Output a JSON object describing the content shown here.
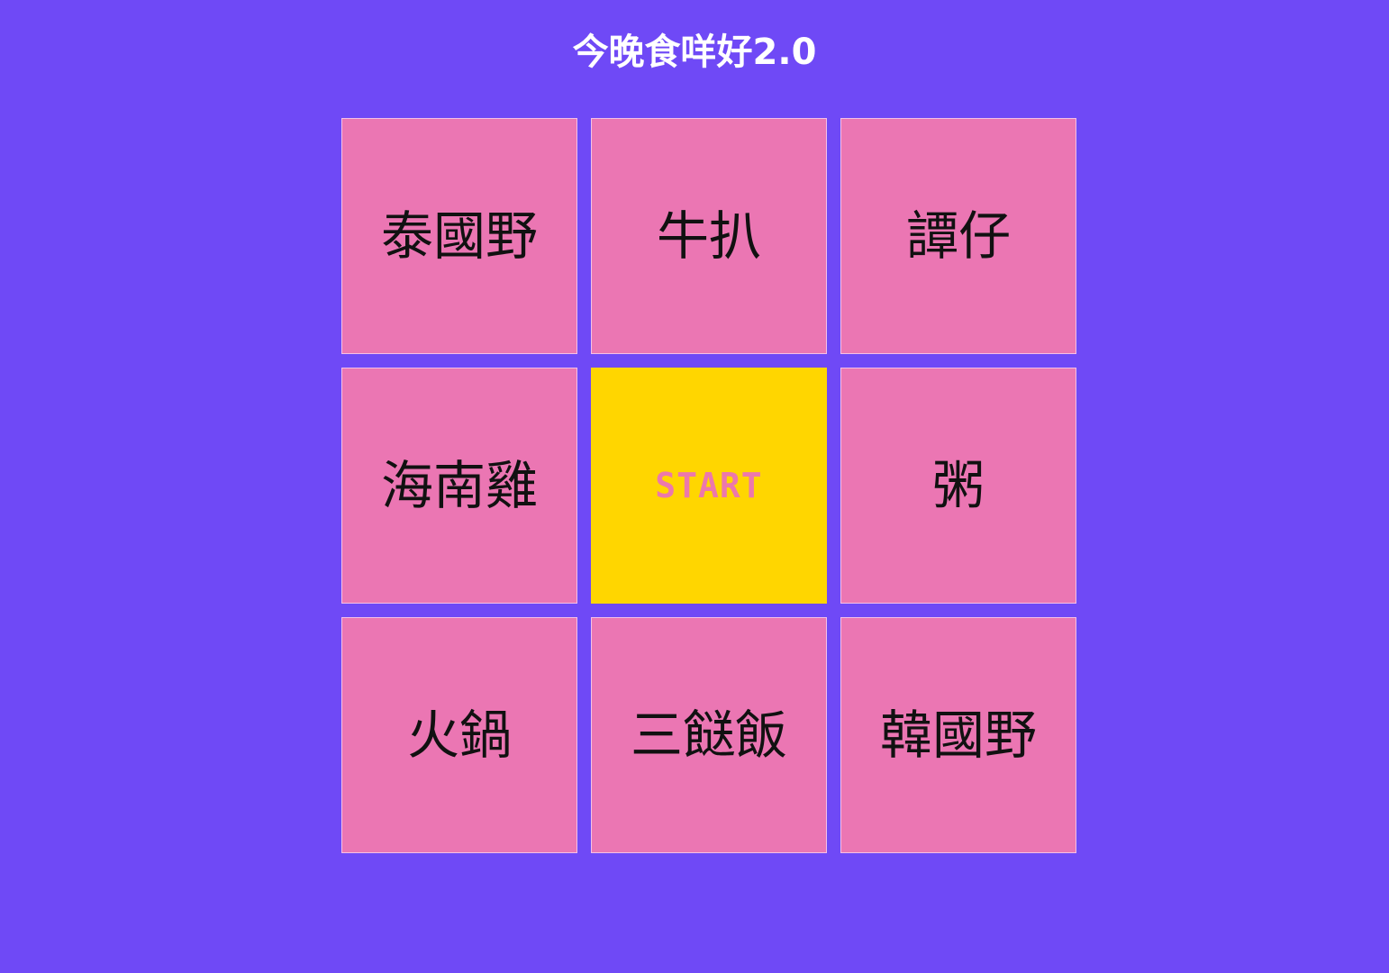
{
  "header": {
    "title": "今晚食咩好2.0"
  },
  "board": {
    "cells": [
      {
        "label": "泰國野"
      },
      {
        "label": "牛扒"
      },
      {
        "label": "譚仔"
      },
      {
        "label": "海南雞"
      },
      {
        "label": "START"
      },
      {
        "label": "粥"
      },
      {
        "label": "火鍋"
      },
      {
        "label": "三餸飯"
      },
      {
        "label": "韓國野"
      }
    ]
  },
  "colors": {
    "background": "#6f49f6",
    "tile": "#eb76b3",
    "start_button": "#ffd600",
    "start_text": "#ec78ac",
    "title_text": "#ffffff",
    "tile_text": "#111111"
  }
}
